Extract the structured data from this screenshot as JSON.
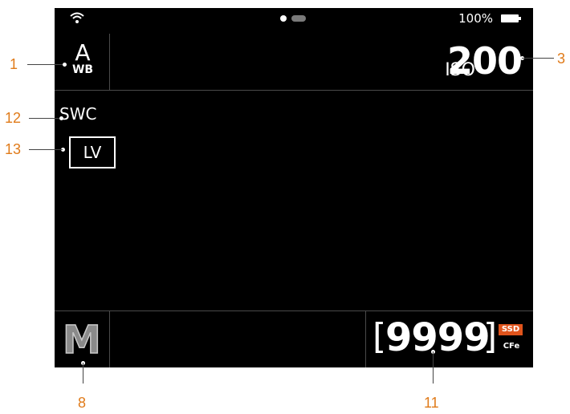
{
  "status_bar": {
    "battery_percent": "100%",
    "page_indicator": {
      "active": 1,
      "total": 2
    },
    "icons": [
      "wifi-icon",
      "battery-icon"
    ]
  },
  "top_bar": {
    "white_balance": {
      "mode": "A",
      "sub_label": "WB"
    },
    "iso": {
      "label": "ISO",
      "value": "200"
    }
  },
  "info": {
    "lens_label": "SWC",
    "live_view_label": "LV"
  },
  "bottom_bar": {
    "exposure_mode": "M",
    "shots_remaining": "9999",
    "bracket_open": "[",
    "bracket_close": "]",
    "storage_badge": "SSD",
    "storage_type": "CFe"
  },
  "callouts": {
    "c1": "1",
    "c3": "3",
    "c8": "8",
    "c11": "11",
    "c12": "12",
    "c13": "13"
  },
  "colors": {
    "screen_bg": "#000000",
    "callout": "#e07b1a",
    "ssd_badge": "#e0541c",
    "divider": "#4a4a4a"
  }
}
